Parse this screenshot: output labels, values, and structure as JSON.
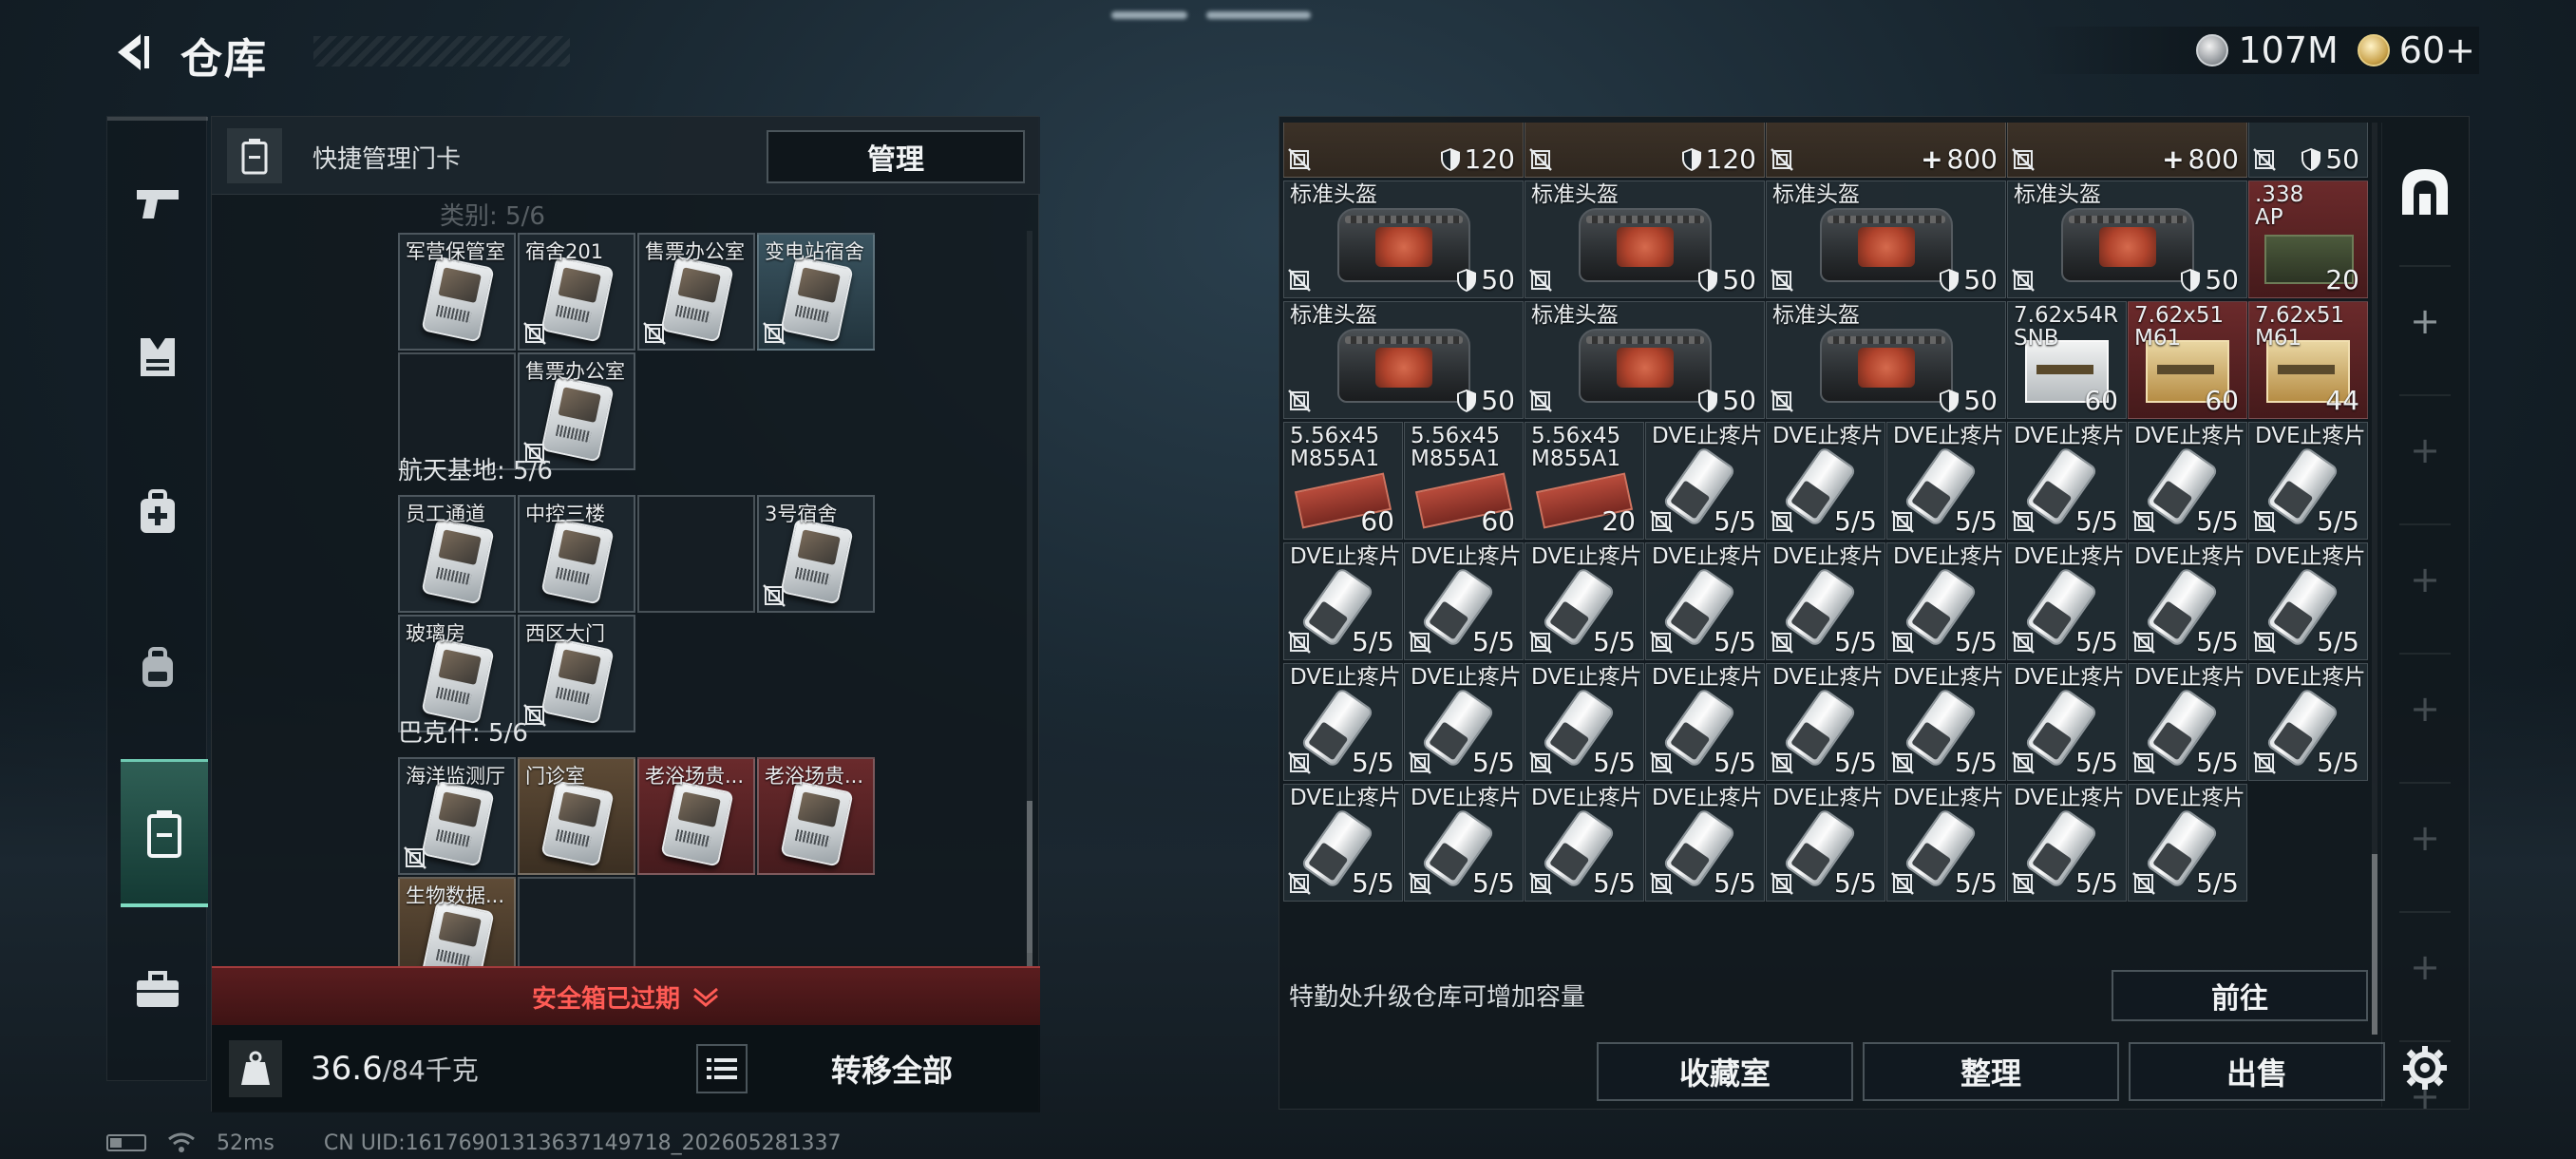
{
  "header": {
    "title": "仓库",
    "currencies": [
      {
        "icon": "silver-coin-icon",
        "value": "107M"
      },
      {
        "icon": "gold-coin-icon",
        "value": "60+"
      }
    ]
  },
  "left_rail": {
    "items": [
      {
        "name": "weapons",
        "icon": "pistol-icon"
      },
      {
        "name": "armor",
        "icon": "vest-icon"
      },
      {
        "name": "medical",
        "icon": "medical-bag-icon"
      },
      {
        "name": "backpack",
        "icon": "backpack-icon"
      },
      {
        "name": "keycards",
        "icon": "keycard-holder-icon",
        "active": true
      },
      {
        "name": "toolbox",
        "icon": "toolbox-icon"
      }
    ]
  },
  "key_panel": {
    "title": "快捷管理门卡",
    "manage_label": "管理",
    "ghost_label": "类别: 5/6",
    "groups": [
      {
        "title": "",
        "cards": [
          {
            "name": "军营保管室",
            "tone": "normal",
            "nosell": false
          },
          {
            "name": "宿舍201",
            "tone": "normal",
            "nosell": true
          },
          {
            "name": "售票办公室",
            "tone": "normal",
            "nosell": true
          },
          {
            "name": "变电站宿舍",
            "tone": "blue",
            "nosell": true
          },
          {
            "name": "",
            "tone": "empty",
            "nosell": false
          },
          {
            "name": "售票办公室",
            "tone": "normal",
            "nosell": true
          }
        ]
      },
      {
        "title": "航天基地: 5/6",
        "cards": [
          {
            "name": "员工通道",
            "tone": "normal",
            "nosell": false
          },
          {
            "name": "中控三楼",
            "tone": "normal",
            "nosell": false
          },
          {
            "name": "",
            "tone": "empty",
            "nosell": false
          },
          {
            "name": "3号宿舍",
            "tone": "normal",
            "nosell": true
          },
          {
            "name": "玻璃房",
            "tone": "normal",
            "nosell": false
          },
          {
            "name": "西区大门",
            "tone": "normal",
            "nosell": true
          }
        ]
      },
      {
        "title": "巴克什: 5/6",
        "cards": [
          {
            "name": "海洋监测厅",
            "tone": "normal",
            "nosell": true
          },
          {
            "name": "门诊室",
            "tone": "gold",
            "nosell": false
          },
          {
            "name": "老浴场贵...",
            "tone": "red",
            "nosell": false
          },
          {
            "name": "老浴场贵...",
            "tone": "red",
            "nosell": false
          },
          {
            "name": "生物数据...",
            "tone": "gold",
            "nosell": false
          },
          {
            "name": "",
            "tone": "empty",
            "nosell": false
          }
        ]
      }
    ],
    "expired_label": "安全箱已过期",
    "weight_value": "36.6",
    "weight_max": "/84千克",
    "transfer_label": "转移全部"
  },
  "status": {
    "ping": "52ms",
    "uid": "CN UID:16176901313637149718_202605281337"
  },
  "inventory": {
    "rows": [
      [
        {
          "name": "",
          "icon": "device",
          "wide": true,
          "tone": "brown",
          "qty": "120",
          "qty_icon": "shield",
          "nosell": true
        },
        {
          "name": "",
          "icon": "device",
          "wide": true,
          "tone": "brown",
          "qty": "120",
          "qty_icon": "shield",
          "nosell": true
        },
        {
          "name": "",
          "icon": "medkit",
          "wide": true,
          "tone": "brown",
          "qty": "800",
          "qty_icon": "plus",
          "nosell": true
        },
        {
          "name": "",
          "icon": "medkit",
          "wide": true,
          "tone": "brown",
          "qty": "800",
          "qty_icon": "plus",
          "nosell": true
        },
        {
          "name": "",
          "icon": "gear",
          "wide": false,
          "tone": "normal",
          "qty": "50",
          "qty_icon": "shield",
          "nosell": true
        }
      ],
      [
        {
          "name": "标准头盔",
          "icon": "helmet",
          "wide": true,
          "tone": "normal",
          "qty": "50",
          "qty_icon": "shield",
          "nosell": true
        },
        {
          "name": "标准头盔",
          "icon": "helmet",
          "wide": true,
          "tone": "normal",
          "qty": "50",
          "qty_icon": "shield",
          "nosell": true
        },
        {
          "name": "标准头盔",
          "icon": "helmet",
          "wide": true,
          "tone": "normal",
          "qty": "50",
          "qty_icon": "shield",
          "nosell": true
        },
        {
          "name": "标准头盔",
          "icon": "helmet",
          "wide": true,
          "tone": "normal",
          "qty": "50",
          "qty_icon": "shield",
          "nosell": true
        },
        {
          "name": ".338\nAP",
          "icon": "ammo-can",
          "wide": false,
          "tone": "red",
          "qty": "20",
          "qty_icon": "",
          "nosell": false
        }
      ],
      [
        {
          "name": "标准头盔",
          "icon": "helmet",
          "wide": true,
          "tone": "normal",
          "qty": "50",
          "qty_icon": "shield",
          "nosell": true
        },
        {
          "name": "标准头盔",
          "icon": "helmet",
          "wide": true,
          "tone": "normal",
          "qty": "50",
          "qty_icon": "shield",
          "nosell": true
        },
        {
          "name": "标准头盔",
          "icon": "helmet",
          "wide": true,
          "tone": "normal",
          "qty": "50",
          "qty_icon": "shield",
          "nosell": true
        },
        {
          "name": "7.62x54R\nSNB",
          "icon": "ammo-box-white",
          "wide": false,
          "tone": "normal",
          "qty": "60",
          "qty_icon": "",
          "nosell": false
        },
        {
          "name": "7.62x51\nM61",
          "icon": "ammo-box",
          "wide": false,
          "tone": "red",
          "qty": "60",
          "qty_icon": "",
          "nosell": false
        },
        {
          "name": "7.62x51\nM61",
          "icon": "ammo-box",
          "wide": false,
          "tone": "red",
          "qty": "44",
          "qty_icon": "",
          "nosell": false
        }
      ],
      [
        {
          "name": "5.56x45\nM855A1",
          "icon": "ammo-red",
          "wide": false,
          "tone": "normal",
          "qty": "60",
          "qty_icon": "",
          "nosell": false
        },
        {
          "name": "5.56x45\nM855A1",
          "icon": "ammo-red",
          "wide": false,
          "tone": "normal",
          "qty": "60",
          "qty_icon": "",
          "nosell": false
        },
        {
          "name": "5.56x45\nM855A1",
          "icon": "ammo-red",
          "wide": false,
          "tone": "normal",
          "qty": "20",
          "qty_icon": "",
          "nosell": false
        },
        {
          "name": "DVE止疼片",
          "icon": "pill",
          "wide": false,
          "tone": "normal",
          "qty": "5/5",
          "qty_icon": "",
          "nosell": true
        },
        {
          "name": "DVE止疼片",
          "icon": "pill",
          "wide": false,
          "tone": "normal",
          "qty": "5/5",
          "qty_icon": "",
          "nosell": true
        },
        {
          "name": "DVE止疼片",
          "icon": "pill",
          "wide": false,
          "tone": "normal",
          "qty": "5/5",
          "qty_icon": "",
          "nosell": true
        },
        {
          "name": "DVE止疼片",
          "icon": "pill",
          "wide": false,
          "tone": "normal",
          "qty": "5/5",
          "qty_icon": "",
          "nosell": true
        },
        {
          "name": "DVE止疼片",
          "icon": "pill",
          "wide": false,
          "tone": "normal",
          "qty": "5/5",
          "qty_icon": "",
          "nosell": true
        },
        {
          "name": "DVE止疼片",
          "icon": "pill",
          "wide": false,
          "tone": "normal",
          "qty": "5/5",
          "qty_icon": "",
          "nosell": true
        }
      ],
      [
        {
          "name": "DVE止疼片",
          "icon": "pill",
          "wide": false,
          "tone": "normal",
          "qty": "5/5",
          "qty_icon": "",
          "nosell": true
        },
        {
          "name": "DVE止疼片",
          "icon": "pill",
          "wide": false,
          "tone": "normal",
          "qty": "5/5",
          "qty_icon": "",
          "nosell": true
        },
        {
          "name": "DVE止疼片",
          "icon": "pill",
          "wide": false,
          "tone": "normal",
          "qty": "5/5",
          "qty_icon": "",
          "nosell": true
        },
        {
          "name": "DVE止疼片",
          "icon": "pill",
          "wide": false,
          "tone": "normal",
          "qty": "5/5",
          "qty_icon": "",
          "nosell": true
        },
        {
          "name": "DVE止疼片",
          "icon": "pill",
          "wide": false,
          "tone": "normal",
          "qty": "5/5",
          "qty_icon": "",
          "nosell": true
        },
        {
          "name": "DVE止疼片",
          "icon": "pill",
          "wide": false,
          "tone": "normal",
          "qty": "5/5",
          "qty_icon": "",
          "nosell": true
        },
        {
          "name": "DVE止疼片",
          "icon": "pill",
          "wide": false,
          "tone": "normal",
          "qty": "5/5",
          "qty_icon": "",
          "nosell": true
        },
        {
          "name": "DVE止疼片",
          "icon": "pill",
          "wide": false,
          "tone": "normal",
          "qty": "5/5",
          "qty_icon": "",
          "nosell": true
        },
        {
          "name": "DVE止疼片",
          "icon": "pill",
          "wide": false,
          "tone": "normal",
          "qty": "5/5",
          "qty_icon": "",
          "nosell": true
        }
      ],
      [
        {
          "name": "DVE止疼片",
          "icon": "pill",
          "wide": false,
          "tone": "normal",
          "qty": "5/5",
          "qty_icon": "",
          "nosell": true
        },
        {
          "name": "DVE止疼片",
          "icon": "pill",
          "wide": false,
          "tone": "normal",
          "qty": "5/5",
          "qty_icon": "",
          "nosell": true
        },
        {
          "name": "DVE止疼片",
          "icon": "pill",
          "wide": false,
          "tone": "normal",
          "qty": "5/5",
          "qty_icon": "",
          "nosell": true
        },
        {
          "name": "DVE止疼片",
          "icon": "pill",
          "wide": false,
          "tone": "normal",
          "qty": "5/5",
          "qty_icon": "",
          "nosell": true
        },
        {
          "name": "DVE止疼片",
          "icon": "pill",
          "wide": false,
          "tone": "normal",
          "qty": "5/5",
          "qty_icon": "",
          "nosell": true
        },
        {
          "name": "DVE止疼片",
          "icon": "pill",
          "wide": false,
          "tone": "normal",
          "qty": "5/5",
          "qty_icon": "",
          "nosell": true
        },
        {
          "name": "DVE止疼片",
          "icon": "pill",
          "wide": false,
          "tone": "normal",
          "qty": "5/5",
          "qty_icon": "",
          "nosell": true
        },
        {
          "name": "DVE止疼片",
          "icon": "pill",
          "wide": false,
          "tone": "normal",
          "qty": "5/5",
          "qty_icon": "",
          "nosell": true
        },
        {
          "name": "DVE止疼片",
          "icon": "pill",
          "wide": false,
          "tone": "normal",
          "qty": "5/5",
          "qty_icon": "",
          "nosell": true
        }
      ],
      [
        {
          "name": "DVE止疼片",
          "icon": "pill",
          "wide": false,
          "tone": "normal",
          "qty": "5/5",
          "qty_icon": "",
          "nosell": true
        },
        {
          "name": "DVE止疼片",
          "icon": "pill",
          "wide": false,
          "tone": "normal",
          "qty": "5/5",
          "qty_icon": "",
          "nosell": true
        },
        {
          "name": "DVE止疼片",
          "icon": "pill",
          "wide": false,
          "tone": "normal",
          "qty": "5/5",
          "qty_icon": "",
          "nosell": true
        },
        {
          "name": "DVE止疼片",
          "icon": "pill",
          "wide": false,
          "tone": "normal",
          "qty": "5/5",
          "qty_icon": "",
          "nosell": true
        },
        {
          "name": "DVE止疼片",
          "icon": "pill",
          "wide": false,
          "tone": "normal",
          "qty": "5/5",
          "qty_icon": "",
          "nosell": true
        },
        {
          "name": "DVE止疼片",
          "icon": "pill",
          "wide": false,
          "tone": "normal",
          "qty": "5/5",
          "qty_icon": "",
          "nosell": true
        },
        {
          "name": "DVE止疼片",
          "icon": "pill",
          "wide": false,
          "tone": "normal",
          "qty": "5/5",
          "qty_icon": "",
          "nosell": true
        },
        {
          "name": "DVE止疼片",
          "icon": "pill",
          "wide": false,
          "tone": "normal",
          "qty": "5/5",
          "qty_icon": "",
          "nosell": true
        }
      ]
    ],
    "upgrade_tip": "特勤处升级仓库可增加容量",
    "goto_label": "前往",
    "buttons": {
      "collection": "收藏室",
      "sort": "整理",
      "sell": "出售"
    },
    "side_tabs": [
      {
        "icon": "storage-arch-icon",
        "active": true
      },
      {
        "icon": "plus-icon"
      },
      {
        "icon": "plus-icon"
      },
      {
        "icon": "plus-icon"
      },
      {
        "icon": "plus-icon"
      },
      {
        "icon": "plus-icon"
      },
      {
        "icon": "plus-icon"
      },
      {
        "icon": "plus-icon"
      }
    ],
    "settings_icon": "gear-icon"
  },
  "colors": {
    "accent_teal": "#7fdcc2",
    "expired_red": "#ff5b55",
    "panel_bg": "#11181d"
  }
}
